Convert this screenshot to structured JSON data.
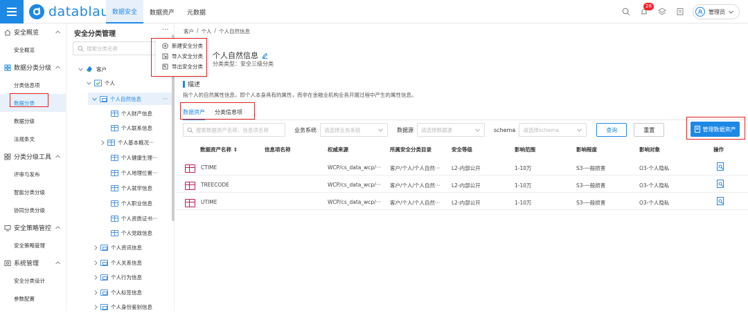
{
  "app": {
    "logo_text": "datablau"
  },
  "topnav": {
    "tabs": [
      "数据安全",
      "数据资产",
      "元数据"
    ],
    "active": 0
  },
  "topright": {
    "notification_count": "28",
    "user_name": "管理员"
  },
  "leftnav": [
    {
      "label": "安全概览",
      "children": [
        "安全概览"
      ]
    },
    {
      "label": "数据分类分级",
      "children": [
        "分类信息项",
        "数据分类",
        "数据分级",
        "法规条文"
      ]
    },
    {
      "label": "分类分级工具",
      "children": [
        "评审与发布",
        "智能分类分级",
        "协同分类分级"
      ]
    },
    {
      "label": "安全策略管控",
      "children": [
        "安全策略管理"
      ]
    },
    {
      "label": "系统管理",
      "children": [
        "安全分类设计",
        "参数配置"
      ]
    }
  ],
  "leftnav_selected": "数据分类",
  "tree": {
    "title": "安全分类管理",
    "more": "···",
    "search_placeholder": "搜索分类名称",
    "nodes": [
      "客户",
      "个人",
      "个人自然信息",
      "个人财产信息",
      "个人联系信息",
      "个人基本概况···",
      "个人健康生理···",
      "个人地理位置···",
      "个人就学信息",
      "个人职业信息",
      "个人资质证书···",
      "个人党政信息",
      "个人资讯信息",
      "个人关系信息",
      "个人行为信息",
      "个人标签信息",
      "个人身份鉴别信息"
    ],
    "selected_more": "···"
  },
  "dropdown": {
    "items": [
      "新建安全分类",
      "导入安全分类",
      "导出安全分类"
    ]
  },
  "main": {
    "breadcrumb": [
      "客户",
      "/",
      "个人",
      "/",
      "个人自然信息"
    ],
    "title": "个人自然信息",
    "subtitle": "分类类型：安全三级分类",
    "section_title": "描述",
    "description": "指个人的自然属性信息，即个人本身具有的属性，而非在金融业机构业务开展过程中产生的属性信息。",
    "tabs": [
      "数据资产",
      "分类信息项"
    ],
    "active_tab": 0,
    "filters": {
      "search_placeholder": "搜索数据资产名称、信息项名称",
      "system_label": "业务系统",
      "system_placeholder": "请选择业务系统",
      "source_label": "数据源",
      "source_placeholder": "请选择数据源",
      "schema_label": "schema",
      "schema_placeholder": "请选择schema",
      "query_button": "查询",
      "reset_button": "重置",
      "manage_button": "管理数据资产"
    },
    "table": {
      "columns": [
        "数据资产名称 ⇕",
        "信息项名称",
        "权威来源",
        "所属安全分类目录",
        "安全等级",
        "影响范围",
        "影响程度",
        "影响对象",
        "操作"
      ],
      "rows": [
        [
          "CTIME",
          "",
          "WCP/cs_data_wcp/···",
          "客户/个人/个人自然···",
          "L2-内部公开",
          "1-10万",
          "S3-一般损害",
          "O3-个人隐私"
        ],
        [
          "TREECODE",
          "",
          "WCP/cs_data_wcp/···",
          "客户/个人/个人自然···",
          "L2-内部公开",
          "1-10万",
          "S3-一般损害",
          "O3-个人隐私"
        ],
        [
          "UTIME",
          "",
          "WCP/cs_data_wcp/···",
          "客户/个人/个人自然···",
          "L2-内部公开",
          "1-10万",
          "S3-一般损害",
          "O3-个人隐私"
        ]
      ]
    }
  },
  "colors": {
    "accent": "#1e88e5",
    "highlight_box": "#e02020",
    "table_icon": "#c2185b"
  }
}
